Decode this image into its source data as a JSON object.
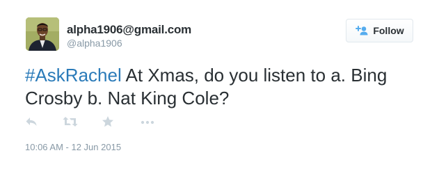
{
  "tweet": {
    "author": {
      "display_name": "alpha1906@gmail.com",
      "handle": "@alpha1906",
      "avatar_icon": "user-avatar"
    },
    "follow_button": {
      "label": "Follow",
      "icon": "add-user-icon"
    },
    "text": {
      "hashtag": "#AskRachel",
      "body": " At Xmas, do you listen to a. Bing Crosby b. Nat King Cole?"
    },
    "actions": [
      {
        "name": "reply",
        "icon": "reply-icon"
      },
      {
        "name": "retweet",
        "icon": "retweet-icon"
      },
      {
        "name": "favorite",
        "icon": "star-icon"
      },
      {
        "name": "more",
        "icon": "more-icon"
      }
    ],
    "timestamp": "10:06 AM - 12 Jun 2015"
  },
  "colors": {
    "text": "#292f33",
    "muted": "#8899a6",
    "link": "#2b7bb9",
    "action_icon": "#ccd6dd",
    "border": "#e1e8ed"
  }
}
